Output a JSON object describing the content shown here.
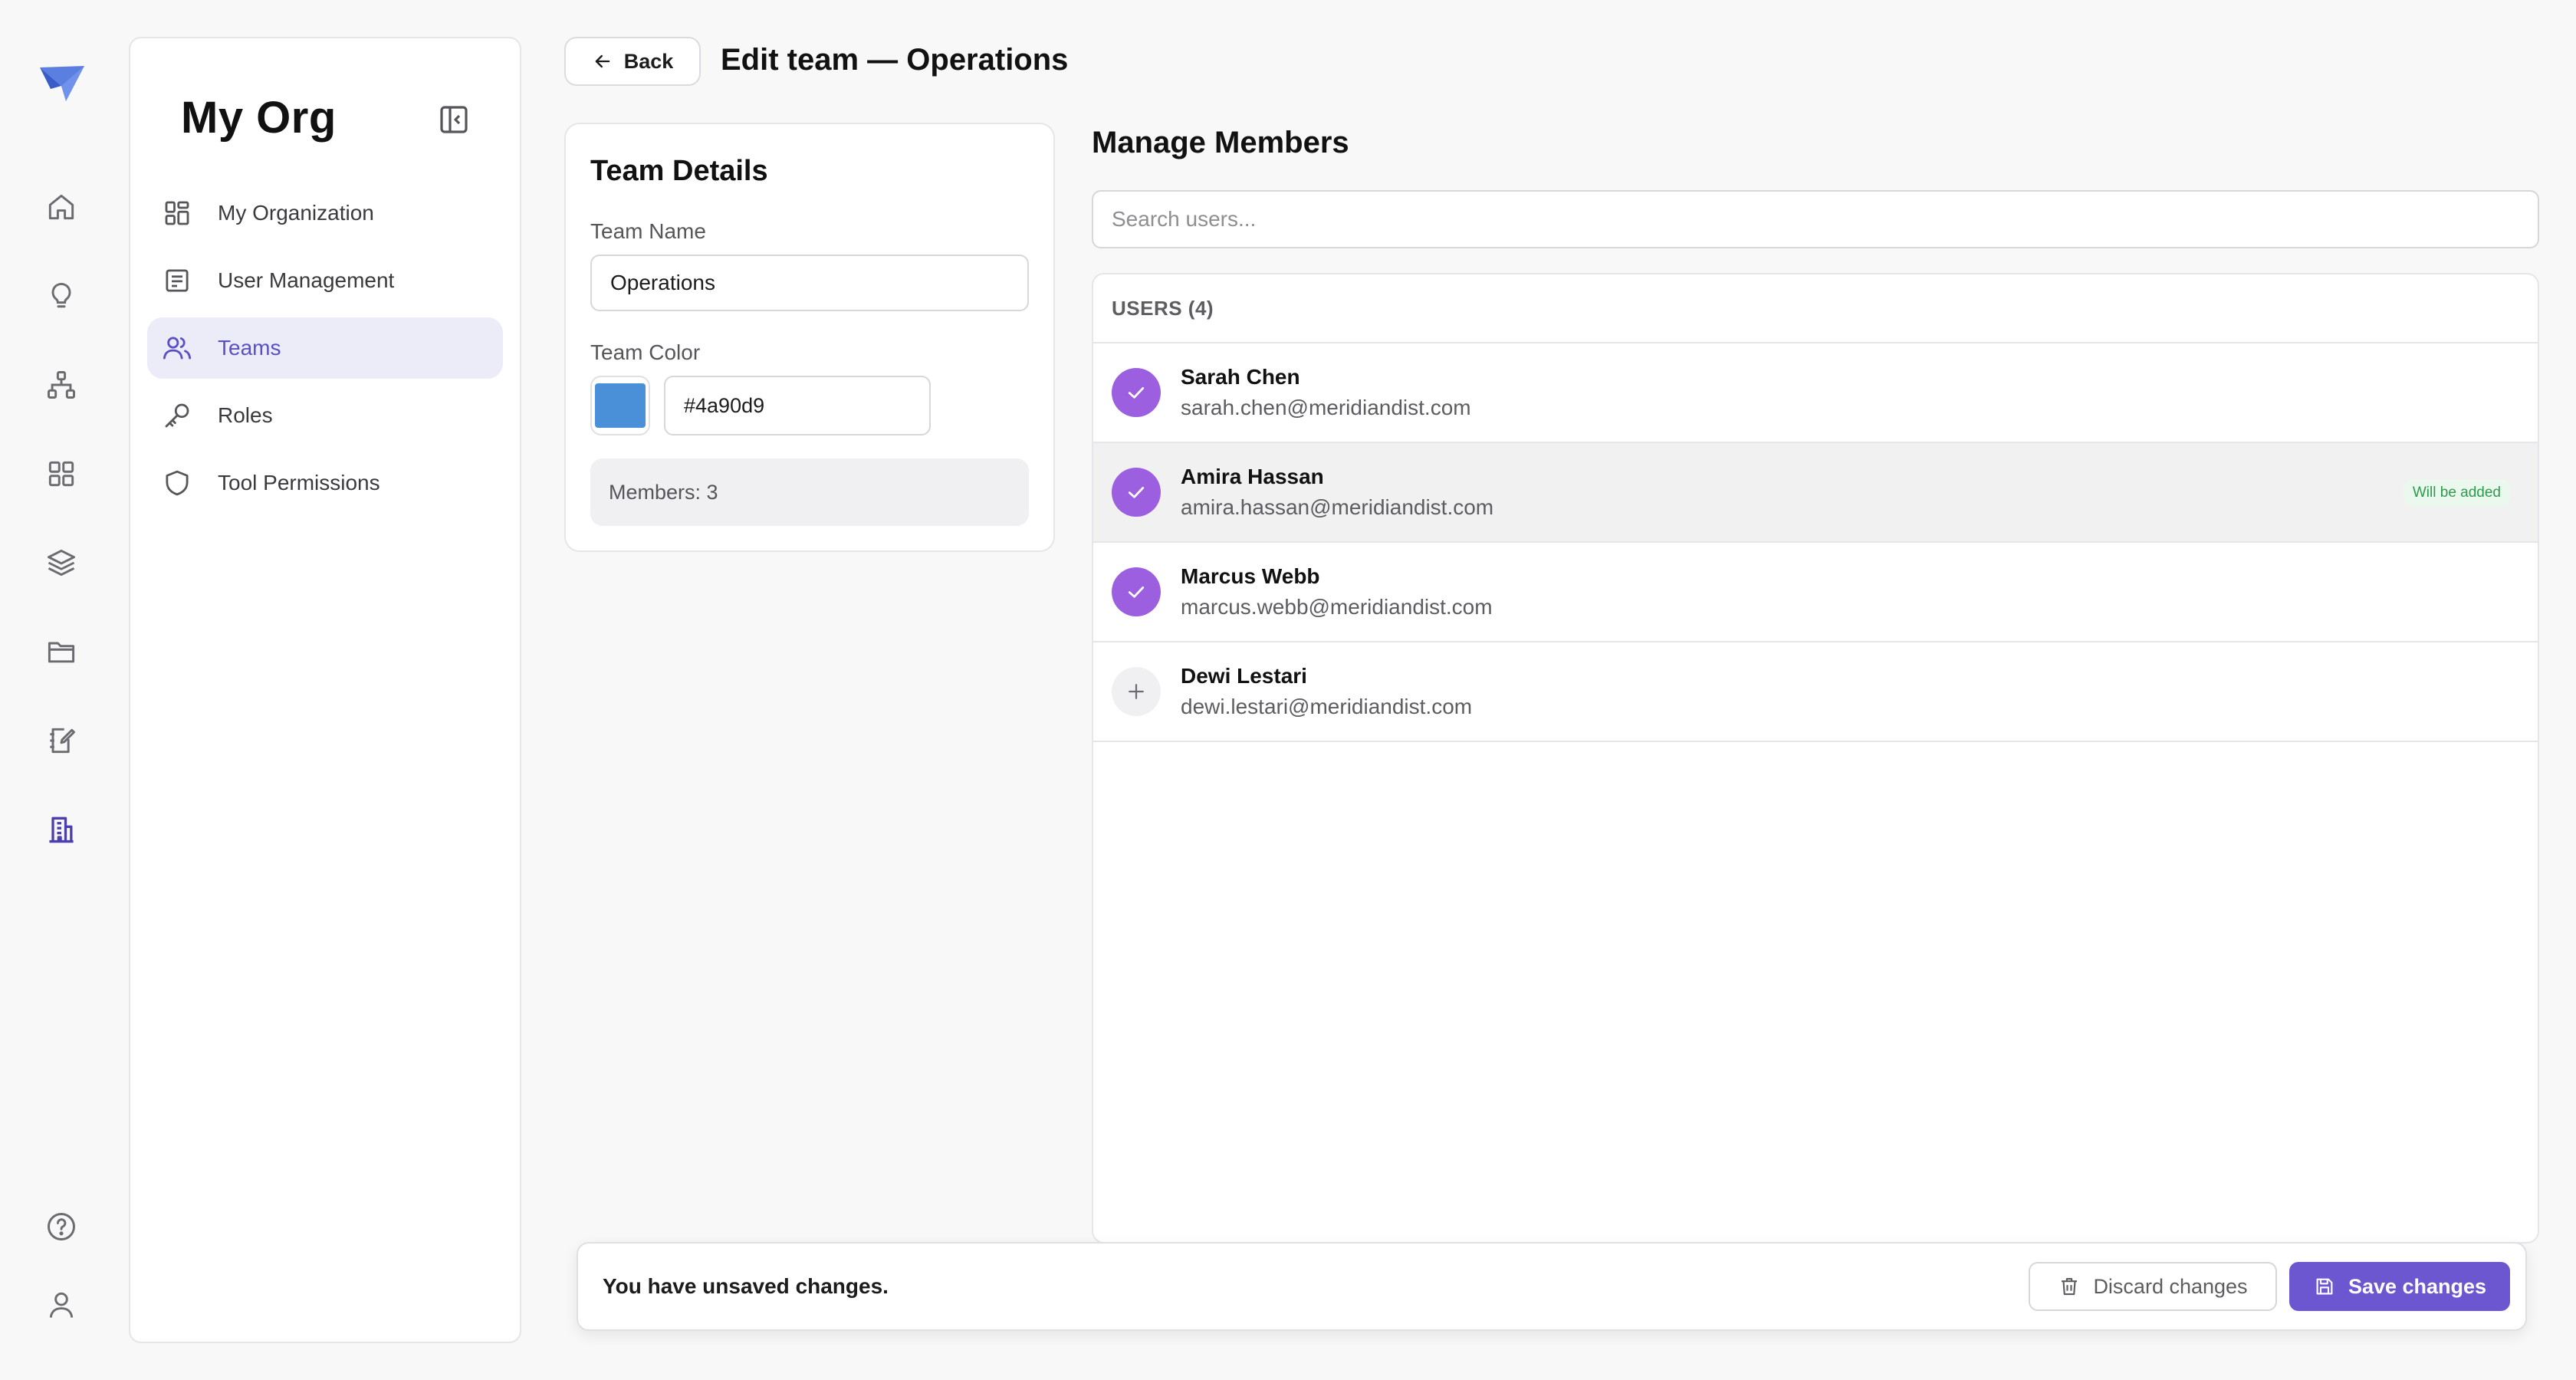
{
  "colors": {
    "accent": "#6c57d0",
    "check": "#9b5fe0",
    "team_color": "#4a90d9",
    "active_nav_bg": "#ecebf8",
    "badge_text": "#2e9a4c"
  },
  "rail": {
    "icons": [
      "logo-icon",
      "home-icon",
      "lightbulb-icon",
      "hierarchy-icon",
      "apps-grid-icon",
      "layers-icon",
      "folder-icon",
      "notebook-edit-icon",
      "building-icon",
      "help-icon",
      "user-icon"
    ],
    "active": "building-icon"
  },
  "sidebar": {
    "title": "My Org",
    "items": [
      {
        "label": "My Organization",
        "icon": "dashboard-icon"
      },
      {
        "label": "User Management",
        "icon": "list-icon"
      },
      {
        "label": "Teams",
        "icon": "users-icon",
        "active": true
      },
      {
        "label": "Roles",
        "icon": "key-icon"
      },
      {
        "label": "Tool Permissions",
        "icon": "shield-icon"
      }
    ]
  },
  "header": {
    "back_label": "Back",
    "title": "Edit team — Operations"
  },
  "team_details": {
    "heading": "Team Details",
    "name_label": "Team Name",
    "name_value": "Operations",
    "color_label": "Team Color",
    "color_value": "#4a90d9",
    "members_text": "Members: 3"
  },
  "members": {
    "heading": "Manage Members",
    "search_placeholder": "Search users...",
    "list_header": "USERS (4)",
    "users": [
      {
        "name": "Sarah Chen",
        "email": "sarah.chen@meridiandist.com",
        "selected": true
      },
      {
        "name": "Amira Hassan",
        "email": "amira.hassan@meridiandist.com",
        "selected": true,
        "badge": "Will be added"
      },
      {
        "name": "Marcus Webb",
        "email": "marcus.webb@meridiandist.com",
        "selected": true
      },
      {
        "name": "Dewi Lestari",
        "email": "dewi.lestari@meridiandist.com",
        "selected": false
      }
    ]
  },
  "unsaved": {
    "message": "You have unsaved changes.",
    "discard_label": "Discard changes",
    "save_label": "Save changes"
  }
}
